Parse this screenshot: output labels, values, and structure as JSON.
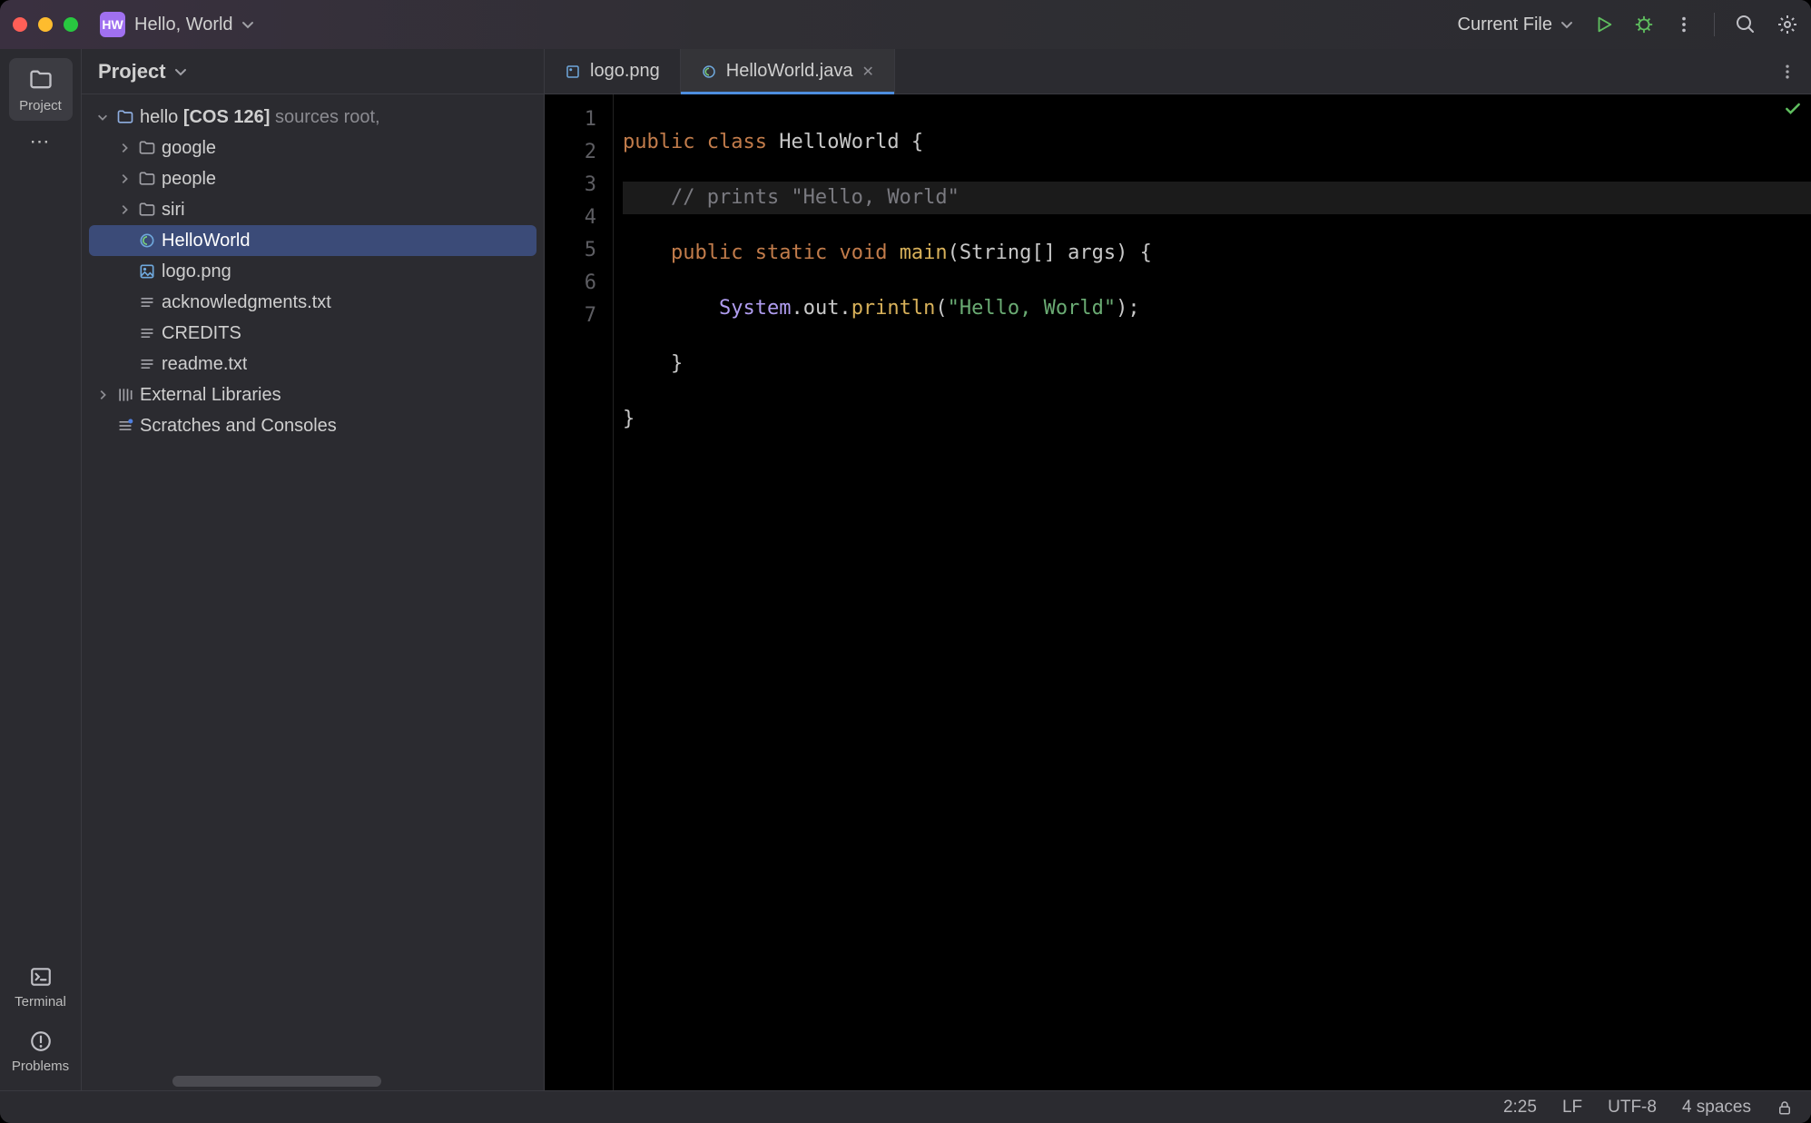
{
  "title": {
    "project_short": "HW",
    "project_name": "Hello, World"
  },
  "run": {
    "config_label": "Current File"
  },
  "leftbar": {
    "project": "Project",
    "more": "⋯",
    "terminal": "Terminal",
    "problems": "Problems"
  },
  "panel": {
    "title": "Project"
  },
  "tree": {
    "root_name": "hello",
    "root_suffix": "[COS 126]",
    "root_hint": "sources root,",
    "folders": [
      "google",
      "people",
      "siri"
    ],
    "file_hello": "HelloWorld",
    "file_logo": "logo.png",
    "file_ack": "acknowledgments.txt",
    "file_credits": "CREDITS",
    "file_readme": "readme.txt",
    "ext_lib": "External Libraries",
    "scratches": "Scratches and Consoles"
  },
  "tabs": {
    "logo": "logo.png",
    "hello": "HelloWorld.java"
  },
  "gutter": [
    "1",
    "2",
    "3",
    "4",
    "5",
    "6",
    "7"
  ],
  "code": {
    "kw_public": "public",
    "kw_class": "class",
    "cls_name": "HelloWorld",
    "brace_open": "{",
    "comment": "// prints \"Hello, World\"",
    "kw_static": "static",
    "kw_void": "void",
    "fn_main": "main",
    "type_string": "String",
    "args_suffix": "[] args) {",
    "sys": "System",
    "out": ".out.",
    "println": "println",
    "paren_open": "(",
    "str": "\"Hello, World\"",
    "line_end": ");",
    "brace_close_inner": "}",
    "brace_close_outer": "}"
  },
  "status": {
    "pos": "2:25",
    "eol": "LF",
    "enc": "UTF-8",
    "indent": "4 spaces"
  }
}
